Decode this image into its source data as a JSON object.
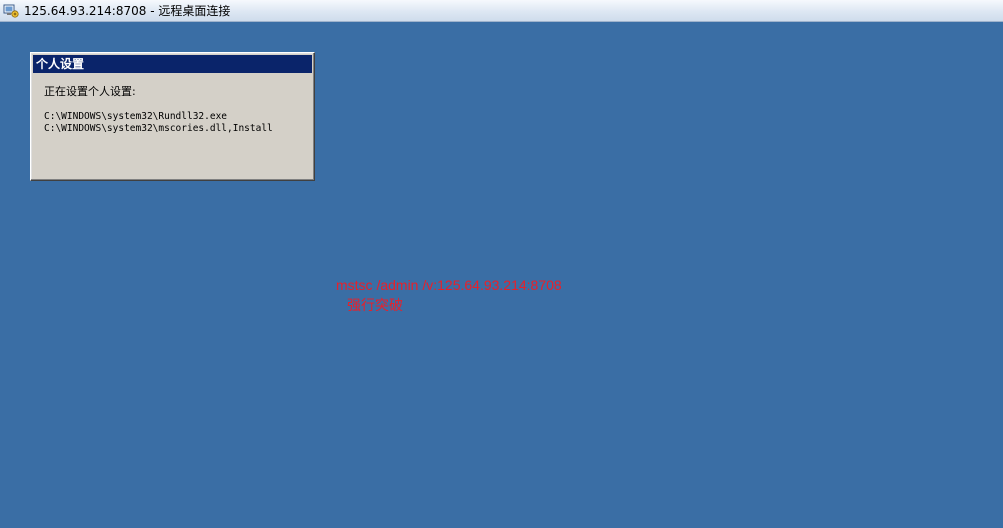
{
  "window": {
    "title": "125.64.93.214:8708 - 远程桌面连接",
    "icon": "remote-desktop-icon"
  },
  "dialog": {
    "caption": "个人设置",
    "status": "正在设置个人设置:",
    "commands": [
      "C:\\WINDOWS\\system32\\Rundll32.exe",
      "C:\\WINDOWS\\system32\\mscories.dll,Install"
    ]
  },
  "annotation": {
    "line1": "mstsc /admin /v:125.64.93.214:8708",
    "line2": "强行突破",
    "color": "#e8202a"
  },
  "colors": {
    "desktop": "#3a6ea5",
    "caption_bar": "#0a246a",
    "dialog_face": "#d4d0c8"
  }
}
